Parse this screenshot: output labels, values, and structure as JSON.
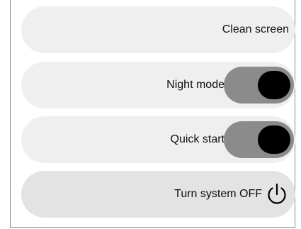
{
  "buttons": {
    "clean_screen": {
      "label": "Clean screen"
    },
    "night_mode": {
      "label": "Night mode",
      "on": true
    },
    "quick_start": {
      "label": "Quick start",
      "on": true
    },
    "turn_off": {
      "label": "Turn system OFF",
      "icon": "power-icon"
    }
  },
  "colors": {
    "row_bg": "#efefef",
    "row_bg_power": "#e3e3e3",
    "toggle_track": "#8b8b8b",
    "toggle_knob": "#000000"
  }
}
